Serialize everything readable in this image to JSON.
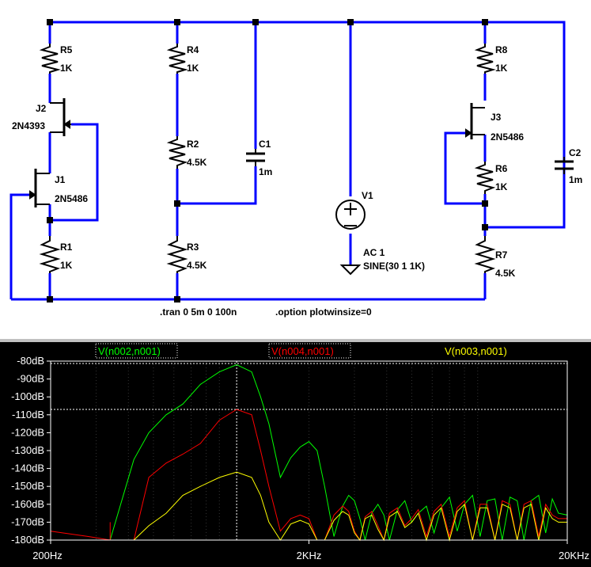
{
  "schematic": {
    "components": {
      "R5": {
        "name": "R5",
        "value": "1K"
      },
      "R4": {
        "name": "R4",
        "value": "1K"
      },
      "R2": {
        "name": "R2",
        "value": "4.5K"
      },
      "R3": {
        "name": "R3",
        "value": "4.5K"
      },
      "R1": {
        "name": "R1",
        "value": "1K"
      },
      "R8": {
        "name": "R8",
        "value": "1K"
      },
      "R6": {
        "name": "R6",
        "value": "1K"
      },
      "R7": {
        "name": "R7",
        "value": "4.5K"
      },
      "C1": {
        "name": "C1",
        "value": "1m"
      },
      "C2": {
        "name": "C2",
        "value": "1m"
      },
      "J1": {
        "name": "J1",
        "value": "2N5486"
      },
      "J2": {
        "name": "J2",
        "value": "2N4393"
      },
      "J3": {
        "name": "J3",
        "value": "2N5486"
      },
      "V1": {
        "name": "V1",
        "ac": "AC 1",
        "sine": "SINE(30 1 1K)"
      }
    },
    "directives": {
      "tran": ".tran 0 5m 0 100n",
      "option": ".option plotwinsize=0"
    },
    "colors": {
      "wire": "#0000ff",
      "component": "#000000",
      "junction": "#000000"
    }
  },
  "plot": {
    "traces": [
      {
        "name": "V(n002,n001)",
        "color": "#00ff00"
      },
      {
        "name": "V(n004,n001)",
        "color": "#ff0000"
      },
      {
        "name": "V(n003,n001)",
        "color": "#ffff00"
      }
    ],
    "y_tick_labels": [
      "-80dB",
      "-90dB",
      "-100dB",
      "-110dB",
      "-120dB",
      "-130dB",
      "-140dB",
      "-150dB",
      "-160dB",
      "-170dB",
      "-180dB"
    ],
    "x_tick_labels": [
      "200Hz",
      "2KHz",
      "20KHz"
    ]
  },
  "chart_data": {
    "type": "line",
    "title": "",
    "xlabel": "",
    "ylabel": "",
    "x_scale": "log",
    "xlim": [
      200,
      20000
    ],
    "ylim": [
      -180,
      -80
    ],
    "grid": true,
    "series": [
      {
        "name": "V(n002,n001)",
        "color": "#00ff00",
        "x": [
          200,
          340,
          420,
          480,
          560,
          650,
          760,
          900,
          1050,
          1200,
          1300,
          1400,
          1550,
          1700,
          1850,
          2000,
          2150,
          2300,
          2500,
          2700,
          2850,
          3000,
          3150,
          3300,
          3500,
          3700,
          3900,
          4100,
          4400,
          4700,
          5000,
          5300,
          5700,
          6100,
          6500,
          7000,
          7500,
          8000,
          8600,
          9200,
          9800,
          10500,
          11200,
          12000,
          12800,
          13600,
          14500,
          15500,
          16500,
          17500,
          18500,
          20000
        ],
        "y": [
          -180,
          -180,
          -135,
          -120,
          -110,
          -104,
          -93,
          -86,
          -82,
          -86,
          -100,
          -115,
          -145,
          -134,
          -128,
          -125,
          -130,
          -150,
          -178,
          -161,
          -155,
          -158,
          -168,
          -180,
          -165,
          -160,
          -166,
          -180,
          -163,
          -158,
          -170,
          -165,
          -161,
          -176,
          -162,
          -156,
          -175,
          -160,
          -155,
          -178,
          -158,
          -157,
          -180,
          -156,
          -158,
          -180,
          -158,
          -155,
          -176,
          -157,
          -165,
          -166
        ]
      },
      {
        "name": "V(n004,n001)",
        "color": "#ff0000",
        "x": [
          200,
          280,
          340,
          420,
          480,
          560,
          650,
          760,
          900,
          1050,
          1200,
          1300,
          1400,
          1550,
          1700,
          1850,
          2000,
          2150,
          2300,
          2500,
          2700,
          2850,
          3000,
          3150,
          3300,
          3500,
          3700,
          3900,
          4100,
          4400,
          4700,
          5000,
          5300,
          5700,
          6100,
          6500,
          7000,
          7500,
          8000,
          8600,
          9200,
          9800,
          10500,
          11200,
          12000,
          12800,
          13600,
          14500,
          15500,
          16500,
          17500,
          18500,
          20000
        ],
        "y": [
          -175,
          -178,
          -180,
          -180,
          -145,
          -137,
          -132,
          -126,
          -113,
          -107,
          -110,
          -130,
          -150,
          -175,
          -168,
          -166,
          -168,
          -180,
          -180,
          -166,
          -161,
          -164,
          -175,
          -180,
          -167,
          -164,
          -172,
          -180,
          -165,
          -162,
          -172,
          -168,
          -163,
          -178,
          -164,
          -160,
          -178,
          -162,
          -158,
          -180,
          -160,
          -160,
          -180,
          -158,
          -160,
          -180,
          -160,
          -158,
          -178,
          -160,
          -166,
          -168,
          -168
        ]
      },
      {
        "name": "V(n003,n001)",
        "color": "#ffff00",
        "x": [
          420,
          480,
          560,
          650,
          760,
          900,
          1050,
          1200,
          1300,
          1400,
          1550,
          1700,
          1850,
          2000,
          2150,
          2300,
          2500,
          2700,
          2850,
          3000,
          3150,
          3300,
          3500,
          3700,
          3900,
          4100,
          4400,
          4700,
          5000,
          5300,
          5700,
          6100,
          6500,
          7000,
          7500,
          8000,
          8600,
          9200,
          9800,
          10500,
          11200,
          12000,
          12800,
          13600,
          14500,
          15500,
          16500,
          17500,
          18500,
          20000
        ],
        "y": [
          -180,
          -172,
          -165,
          -155,
          -150,
          -145,
          -142,
          -145,
          -155,
          -170,
          -180,
          -171,
          -169,
          -171,
          -180,
          -180,
          -169,
          -164,
          -166,
          -176,
          -180,
          -168,
          -166,
          -174,
          -180,
          -167,
          -164,
          -173,
          -170,
          -165,
          -180,
          -166,
          -162,
          -180,
          -164,
          -160,
          -180,
          -162,
          -162,
          -180,
          -160,
          -162,
          -180,
          -162,
          -160,
          -180,
          -162,
          -168,
          -170,
          -170
        ]
      }
    ]
  }
}
